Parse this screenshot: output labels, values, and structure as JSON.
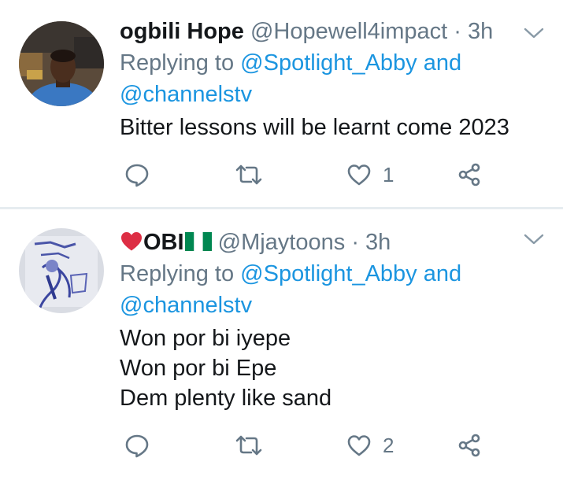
{
  "tweets": [
    {
      "display_name": "ogbili Hope",
      "handle": "@Hopewell4impact",
      "separator": "·",
      "time": "3h",
      "replying_prefix": "Replying to ",
      "replying_to_1": "@Spotlight_Abby",
      "replying_and": " and",
      "replying_to_2": "@channelstv",
      "text_lines": [
        "Bitter lessons will be learnt come 2023"
      ],
      "like_count": "1",
      "icons": [
        "reply-icon",
        "retweet-icon",
        "heart-icon",
        "share-icon",
        "chevron-down-icon"
      ]
    },
    {
      "display_name": "OBI",
      "handle": "@Mjaytoons",
      "separator": "·",
      "time": "3h",
      "replying_prefix": "Replying to ",
      "replying_to_1": "@Spotlight_Abby",
      "replying_and": " and",
      "replying_to_2": "@channelstv",
      "text_lines": [
        "Won por bi iyepe",
        "Won por bi Epe",
        "Dem plenty like sand"
      ],
      "like_count": "2",
      "icons": [
        "red-heart-emoji-icon",
        "nigeria-flag-icon",
        "reply-icon",
        "retweet-icon",
        "heart-icon",
        "share-icon",
        "chevron-down-icon"
      ]
    }
  ],
  "colors": {
    "name": "#14171a",
    "secondary": "#657786",
    "link": "#1b95e0",
    "divider": "#e6ecf0",
    "icon": "#657786"
  }
}
